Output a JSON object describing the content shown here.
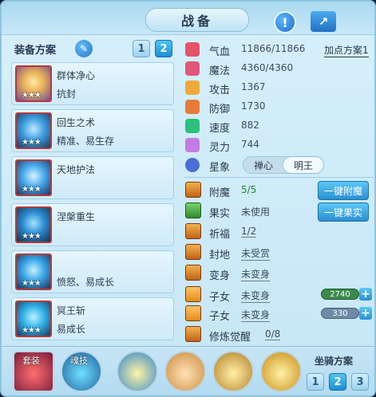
{
  "window": {
    "title": "战备"
  },
  "equipment_plan": {
    "label": "装备方案",
    "plans": [
      "1",
      "2"
    ],
    "active_plan": "2"
  },
  "skills": [
    {
      "name": "群体净心",
      "desc": "抗封",
      "stars": "★★★"
    },
    {
      "name": "回生之术",
      "desc": "精准、易生存",
      "stars": "★★★"
    },
    {
      "name": "天地护法",
      "desc": "",
      "stars": "★★★"
    },
    {
      "name": "涅槃重生",
      "desc": "",
      "stars": "★★★"
    },
    {
      "name": "",
      "desc": "愤怒、易成长",
      "stars": "★★★"
    },
    {
      "name": "冥王斩",
      "desc": "易成长",
      "stars": "★★★"
    }
  ],
  "stats": [
    {
      "label": "气血",
      "value": "11866/11866",
      "color": "#e4536a"
    },
    {
      "label": "魔法",
      "value": "4360/4360",
      "color": "#e0577b"
    },
    {
      "label": "攻击",
      "value": "1367",
      "color": "#f0a93a"
    },
    {
      "label": "防御",
      "value": "1730",
      "color": "#e87b3a"
    },
    {
      "label": "速度",
      "value": "882",
      "color": "#2ebf7a"
    },
    {
      "label": "灵力",
      "value": "744",
      "color": "#c47be4"
    }
  ],
  "add_point_plan": "加点方案1",
  "constellation": {
    "label": "星象",
    "options": [
      "禅心",
      "明王"
    ],
    "selected": "明王"
  },
  "features": [
    {
      "label": "附魔",
      "value": "5/5",
      "style": "green",
      "button": "一键附魔"
    },
    {
      "label": "果实",
      "value": "未使用",
      "style": "",
      "button": "一键果实"
    },
    {
      "label": "祈福",
      "value": "1/2",
      "style": "u",
      "button": ""
    },
    {
      "label": "封地",
      "value": "未受赏",
      "style": "u",
      "button": ""
    },
    {
      "label": "变身",
      "value": "未变身",
      "style": "u",
      "button": ""
    },
    {
      "label": "子女",
      "value": "未变身",
      "style": "u",
      "button": "",
      "gauge": "2740"
    },
    {
      "label": "子女",
      "value": "未变身",
      "style": "u",
      "button": "",
      "gauge": "330"
    },
    {
      "label": "修炼觉醒",
      "value": "0/8",
      "style": "u",
      "button": ""
    }
  ],
  "bottom": {
    "slots": [
      {
        "label": "套装"
      },
      {
        "label": "魂技"
      }
    ],
    "mount_plan_label": "坐骑方案",
    "mount_plans": [
      "1",
      "2",
      "3"
    ],
    "active_mount_plan": "2"
  }
}
